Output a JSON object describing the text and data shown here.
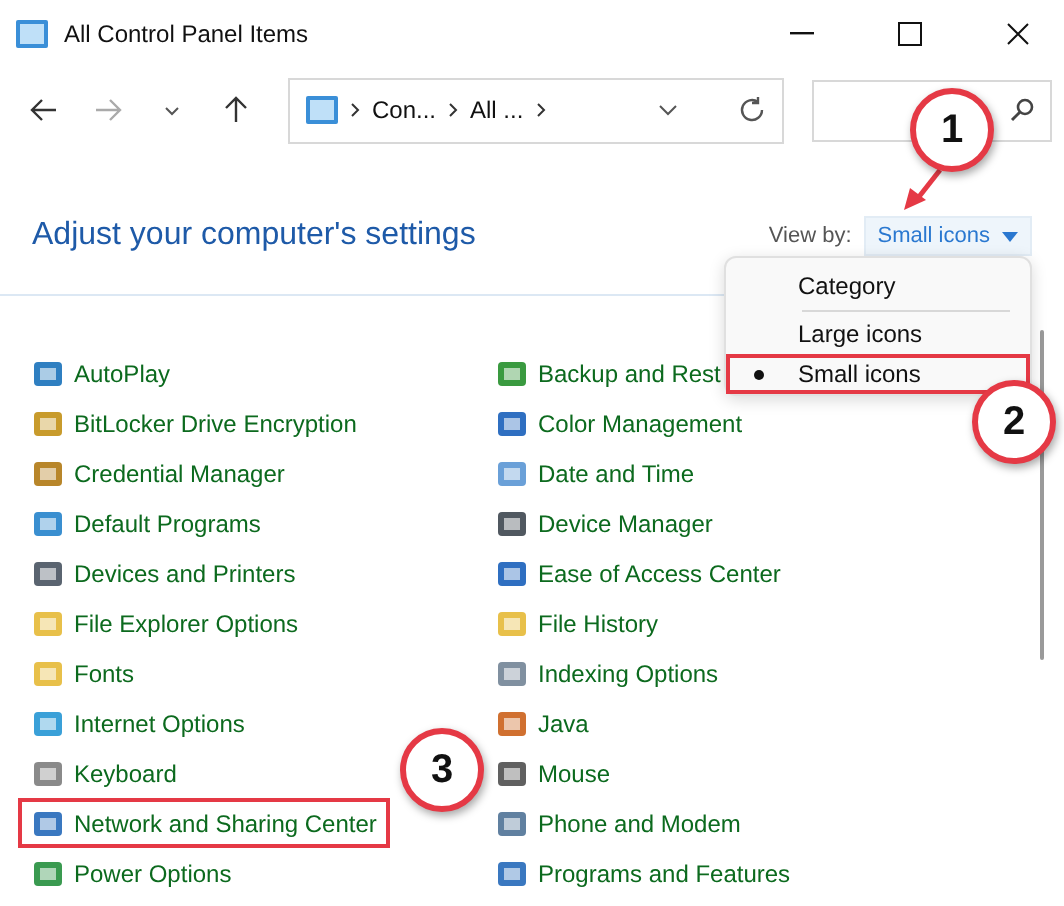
{
  "window": {
    "title": "All Control Panel Items"
  },
  "address": {
    "crumbs": [
      "Con...",
      "All ..."
    ]
  },
  "heading": "Adjust your computer's settings",
  "view_by": {
    "label": "View by:",
    "value": "Small icons"
  },
  "view_menu": {
    "items": [
      {
        "label": "Category",
        "selected": false,
        "highlighted": false
      },
      {
        "label": "Large icons",
        "selected": false,
        "highlighted": false
      },
      {
        "label": "Small icons",
        "selected": true,
        "highlighted": true
      }
    ]
  },
  "columns": [
    {
      "items": [
        {
          "label": "AutoPlay",
          "color": "#2f7fc1"
        },
        {
          "label": "BitLocker Drive Encryption",
          "color": "#c89b2c"
        },
        {
          "label": "Credential Manager",
          "color": "#b8862a"
        },
        {
          "label": "Default Programs",
          "color": "#3a8fd0"
        },
        {
          "label": "Devices and Printers",
          "color": "#5a6470"
        },
        {
          "label": "File Explorer Options",
          "color": "#e8c04a"
        },
        {
          "label": "Fonts",
          "color": "#e8c04a"
        },
        {
          "label": "Internet Options",
          "color": "#3aa0d8"
        },
        {
          "label": "Keyboard",
          "color": "#8a8a8a"
        },
        {
          "label": "Network and Sharing Center",
          "color": "#3a78c0",
          "highlighted": true
        },
        {
          "label": "Power Options",
          "color": "#3a9a50"
        }
      ]
    },
    {
      "items": [
        {
          "label": "Backup and Rest",
          "color": "#3a9a40"
        },
        {
          "label": "Color Management",
          "color": "#2f6fc1"
        },
        {
          "label": "Date and Time",
          "color": "#6aa0d8"
        },
        {
          "label": "Device Manager",
          "color": "#505860"
        },
        {
          "label": "Ease of Access Center",
          "color": "#2f6fc1"
        },
        {
          "label": "File History",
          "color": "#e8c04a"
        },
        {
          "label": "Indexing Options",
          "color": "#8090a0"
        },
        {
          "label": "Java",
          "color": "#d07030"
        },
        {
          "label": "Mouse",
          "color": "#606060"
        },
        {
          "label": "Phone and Modem",
          "color": "#6080a0"
        },
        {
          "label": "Programs and Features",
          "color": "#3a78c0"
        }
      ]
    }
  ],
  "annotations": [
    {
      "label": "1"
    },
    {
      "label": "2"
    },
    {
      "label": "3"
    }
  ]
}
